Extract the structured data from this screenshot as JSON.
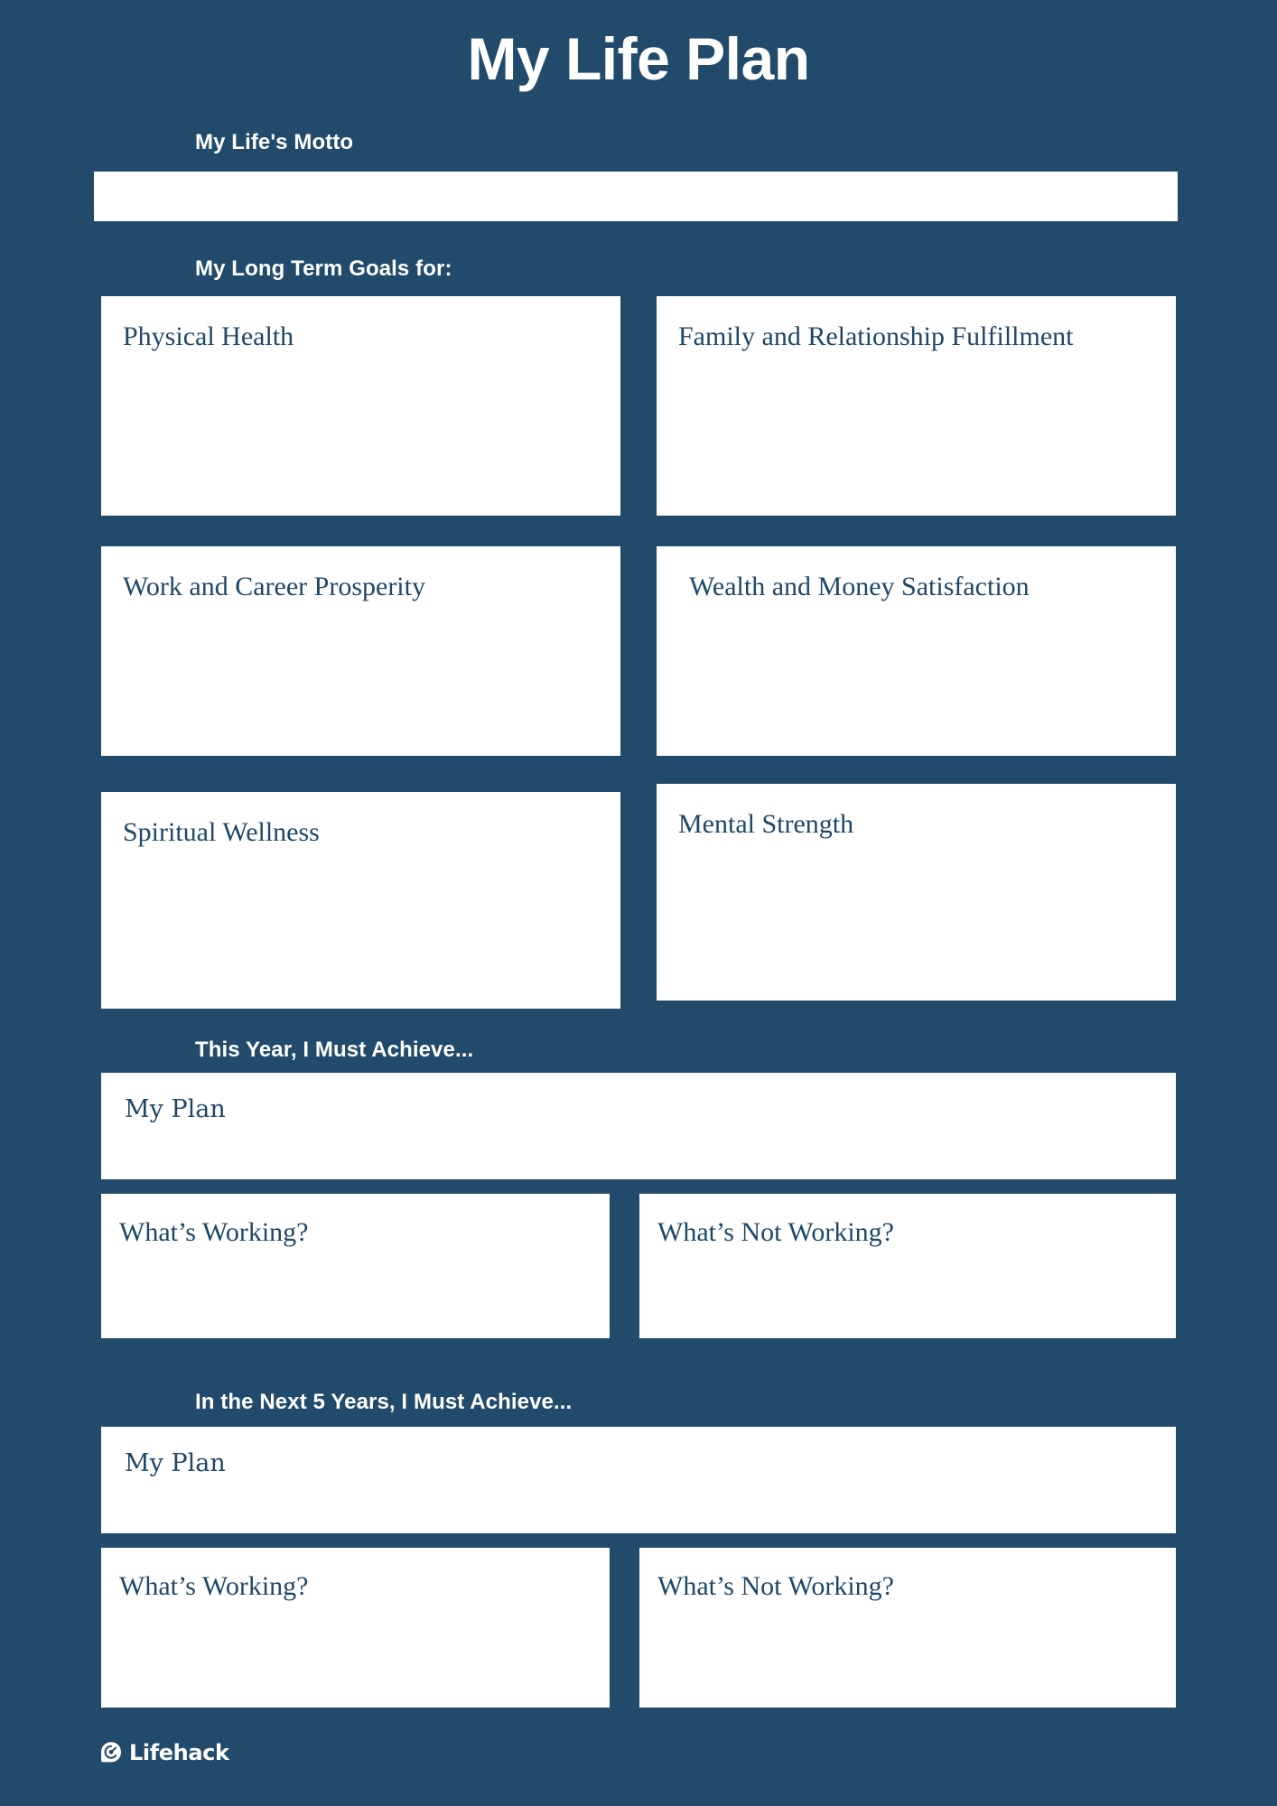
{
  "colors": {
    "background": "#224b6b",
    "card_fill": "#ffffff",
    "card_text": "#1e4868",
    "label_text": "#ffffff"
  },
  "header": {
    "title": "My Life Plan"
  },
  "motto": {
    "label": "My Life's Motto",
    "value": "",
    "placeholder": ""
  },
  "long_term_goals": {
    "label": "My Long Term Goals for:",
    "cards": [
      {
        "label": "Physical Health",
        "value": ""
      },
      {
        "label": "Family and Relationship Fulfillment",
        "value": ""
      },
      {
        "label": "Work and Career Prosperity",
        "value": ""
      },
      {
        "label": "Wealth and Money Satisfaction",
        "value": ""
      },
      {
        "label": "Spiritual Wellness",
        "value": ""
      },
      {
        "label": "Mental Strength",
        "value": ""
      }
    ]
  },
  "this_year": {
    "label": "This Year, I Must Achieve...",
    "plan": {
      "label": "My Plan",
      "value": ""
    },
    "working": {
      "label": "What’s Working?",
      "value": ""
    },
    "not_working": {
      "label": "What’s Not Working?",
      "value": ""
    }
  },
  "next_five_years": {
    "label": "In the Next 5 Years, I Must Achieve...",
    "plan": {
      "label": "My Plan",
      "value": ""
    },
    "working": {
      "label": "What’s Working?",
      "value": ""
    },
    "not_working": {
      "label": "What’s Not Working?",
      "value": ""
    }
  },
  "footer": {
    "brand": "Lifehack",
    "logo_icon": "lifehack-swirl-icon"
  }
}
